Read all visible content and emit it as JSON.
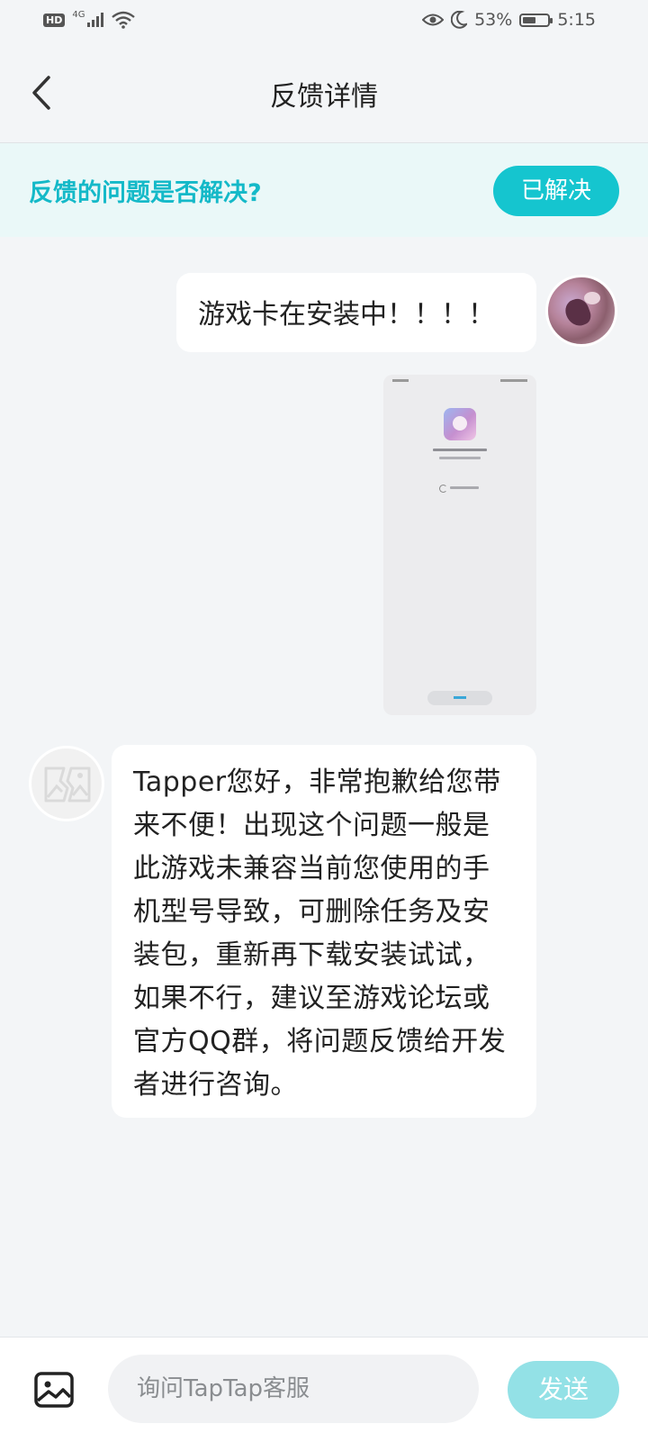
{
  "status_bar": {
    "hd": "HD",
    "network": "4G",
    "battery_text": "53%",
    "battery_level": 0.53,
    "time": "5:15"
  },
  "header": {
    "title": "反馈详情"
  },
  "banner": {
    "question": "反馈的问题是否解决?",
    "resolved_label": "已解决"
  },
  "chat": {
    "user_message": "游戏卡在安装中！！！！",
    "support_message": "Tapper您好，非常抱歉给您带来不便！出现这个问题一般是此游戏未兼容当前您使用的手机型号导致，可删除任务及安装包，重新再下载安装试试，如果不行，建议至游戏论坛或官方QQ群，将问题反馈给开发者进行咨询。"
  },
  "input": {
    "placeholder": "询问TapTap客服",
    "value": "",
    "send_label": "发送"
  },
  "colors": {
    "accent": "#15c5cf",
    "accent_text": "#14b9c8",
    "banner_bg": "#eaf8f8",
    "send_disabled": "#93e1e6",
    "page_bg": "#f3f5f7"
  },
  "icons": {
    "back": "chevron-left-icon",
    "image": "image-icon",
    "support_avatar": "broken-image-icon"
  }
}
